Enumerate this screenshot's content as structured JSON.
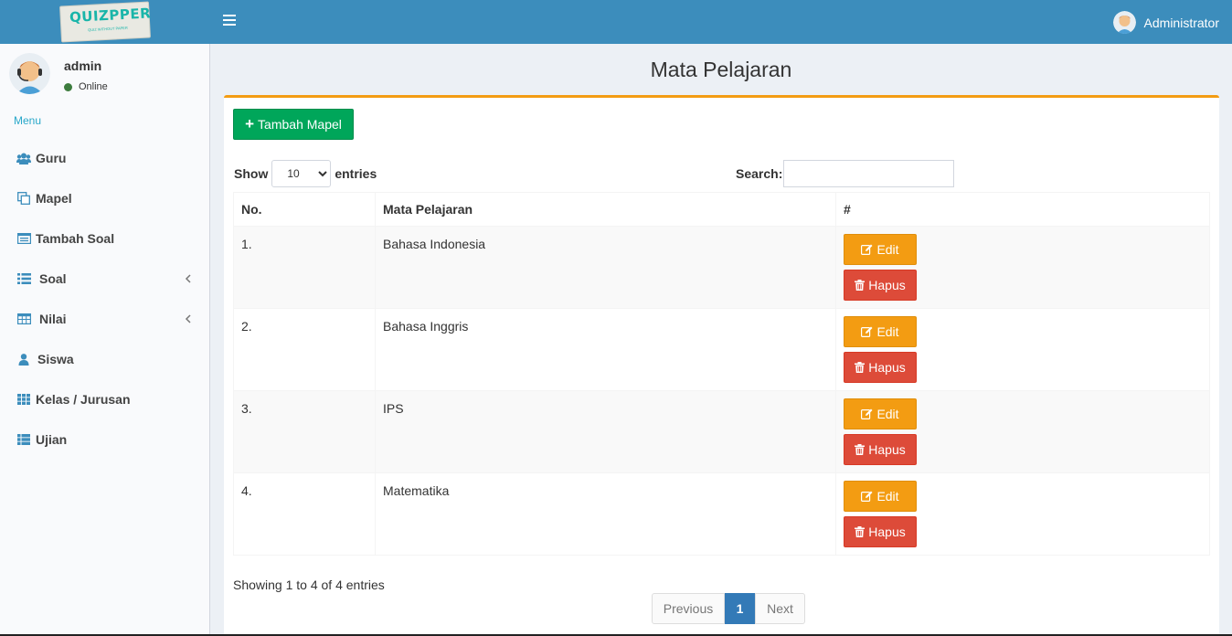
{
  "app": {
    "logo_text": "QUIZPPER",
    "logo_tagline": "QUIZ WITHOUT PAPER",
    "header_user": "Administrator"
  },
  "sidebar": {
    "user_name": "admin",
    "user_status": "Online",
    "menu_header": "Menu",
    "items": [
      {
        "label": "Guru",
        "icon": "users-icon"
      },
      {
        "label": "Mapel",
        "icon": "copy-icon"
      },
      {
        "label": "Tambah Soal",
        "icon": "list-alt-icon"
      },
      {
        "label": "Soal",
        "icon": "list-icon",
        "expandable": true
      },
      {
        "label": "Nilai",
        "icon": "table-icon",
        "expandable": true
      },
      {
        "label": "Siswa",
        "icon": "user-icon"
      },
      {
        "label": "Kelas / Jurusan",
        "icon": "th-icon"
      },
      {
        "label": "Ujian",
        "icon": "th-list-icon"
      }
    ]
  },
  "page": {
    "title": "Mata Pelajaran",
    "add_button": "Tambah Mapel",
    "show_label": "Show",
    "entries_label": "entries",
    "page_length": "10",
    "search_label": "Search:",
    "search_value": ""
  },
  "table": {
    "headers": [
      "No.",
      "Mata Pelajaran",
      "#"
    ],
    "edit_label": "Edit",
    "delete_label": "Hapus",
    "rows": [
      {
        "no": "1.",
        "name": "Bahasa Indonesia"
      },
      {
        "no": "2.",
        "name": "Bahasa Inggris"
      },
      {
        "no": "3.",
        "name": "IPS"
      },
      {
        "no": "4.",
        "name": "Matematika"
      }
    ]
  },
  "footer": {
    "info": "Showing 1 to 4 of 4 entries",
    "prev": "Previous",
    "current": "1",
    "next": "Next"
  },
  "colors": {
    "header": "#3c8dbc",
    "accent": "#f39c12",
    "add": "#00a65a",
    "delete": "#dd4b39",
    "pager_active": "#337ab7"
  }
}
